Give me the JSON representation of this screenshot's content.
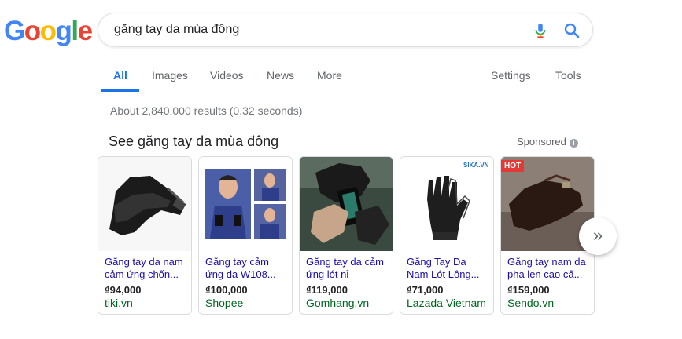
{
  "logo": {
    "letters": [
      "G",
      "o",
      "o",
      "g",
      "l",
      "e"
    ],
    "colors": [
      "#4285F4",
      "#EA4335",
      "#FBBC05",
      "#4285F4",
      "#34A853",
      "#EA4335"
    ]
  },
  "search": {
    "query": "găng tay da mùa đông"
  },
  "tabs": [
    {
      "label": "All",
      "active": true
    },
    {
      "label": "Images"
    },
    {
      "label": "Videos"
    },
    {
      "label": "News"
    },
    {
      "label": "More"
    }
  ],
  "tools": {
    "settings": "Settings",
    "tools": "Tools"
  },
  "stats": "About 2,840,000 results (0.32 seconds)",
  "shopping": {
    "title": "See găng tay da mùa đông",
    "sponsored": "Sponsored",
    "products": [
      {
        "line1": "Găng tay da nam",
        "line2": "cảm ứng chốn...",
        "price": "₫94,000",
        "store": "tiki.vn"
      },
      {
        "line1": "Găng tay cảm",
        "line2": "ứng da W108...",
        "price": "₫100,000",
        "store": "Shopee"
      },
      {
        "line1": "Găng tay da cảm",
        "line2": "ứng lót nỉ",
        "price": "₫119,000",
        "store": "Gomhang.vn"
      },
      {
        "line1": "Găng Tay Da",
        "line2": "Nam Lót Lông...",
        "price": "₫71,000",
        "store": "Lazada Vietnam",
        "badge": "SIKA.VN"
      },
      {
        "line1": "Găng tay nam da",
        "line2": "pha len cao cấ...",
        "price": "₫159,000",
        "store": "Sendo.vn",
        "badge": "HOT"
      }
    ],
    "next_icon": "chevron-double-right-icon"
  },
  "colors": {
    "accent": "#1a73e8",
    "link": "#1a0dab",
    "url_green": "#006621"
  }
}
